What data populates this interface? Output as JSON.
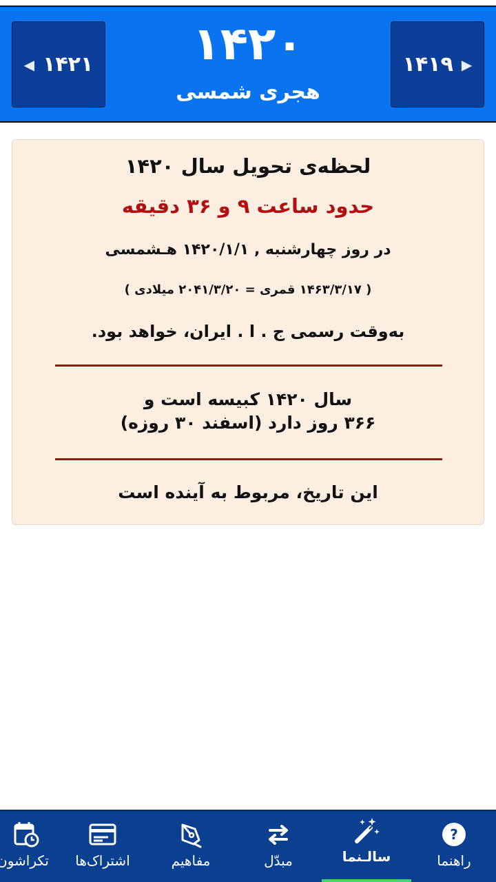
{
  "header": {
    "prev_year": "۱۴۲۱",
    "next_year": "۱۴۱۹",
    "year": "۱۴۲۰",
    "calendar": "هجری شمسی"
  },
  "card": {
    "title": "لحظه‌ی تحویل سال ۱۴۲۰",
    "time": "حدود ساعت ۹ و ۳۶ دقیقه",
    "date_line": "در روز چهارشنبه , ۱۴۲۰/۱/۱ هـشمسی",
    "equivalents": "( ۱۴۶۳/۳/۱۷ قمری = ۲۰۴۱/۳/۲۰ میلادی )",
    "timezone": "به‌وقت رسمی ج . ا . ایران، خواهد بود.",
    "leap_line1": "سال ۱۴۲۰ کبیسه است و",
    "leap_line2": "۳۶۶ روز دارد (اسفند ۳۰ روزه)",
    "note": "این تاریخ، مربوط به آینده است"
  },
  "bottom_nav": {
    "items": [
      {
        "label": "راهنما",
        "icon": "help-icon"
      },
      {
        "label": "سالـنما",
        "icon": "magic-wand-icon",
        "active": true
      },
      {
        "label": "مبدّل",
        "icon": "swap-arrows-icon"
      },
      {
        "label": "مفاهیم",
        "icon": "pen-nib-icon"
      },
      {
        "label": "اشتراک‌ها",
        "icon": "card-icon"
      },
      {
        "label": "تکراشون",
        "icon": "calendar-clock-icon"
      }
    ]
  },
  "colors": {
    "header_bg": "#0a73f0",
    "nav_button_bg": "#0c3f9a",
    "card_bg": "#fcefe2",
    "accent_red": "#b30f12",
    "bottom_nav_bg": "#0b3f8f",
    "active_indicator": "#4ad36a"
  }
}
